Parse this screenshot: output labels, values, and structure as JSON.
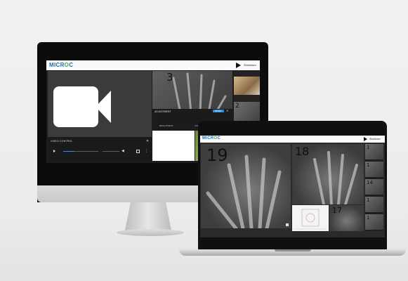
{
  "desktop": {
    "logo_main": "MICR",
    "logo_accent": "O",
    "logo_end": "C",
    "top_right_label": "Shutdown",
    "video_control_label": "VIDEO CONTROL",
    "main_image_number": "3",
    "adjustment_label": "ADJUSTMENT",
    "reset_label": "RESET",
    "brightness_label": "BRIGHTNESS",
    "contrast_label": "CONTRAST",
    "rail_number": "2"
  },
  "laptop": {
    "logo_main": "MICR",
    "logo_accent": "O",
    "logo_end": "C",
    "top_right_label": "Shutdown",
    "big_image_number": "19",
    "mid_image_number": "18",
    "small_image_number": "17",
    "rail_numbers": [
      "1",
      "1",
      "14",
      "1",
      "1"
    ]
  },
  "colors": {
    "accent_blue": "#1a6fb5",
    "accent_green": "#3fae49",
    "reset_blue": "#2a86d8"
  }
}
